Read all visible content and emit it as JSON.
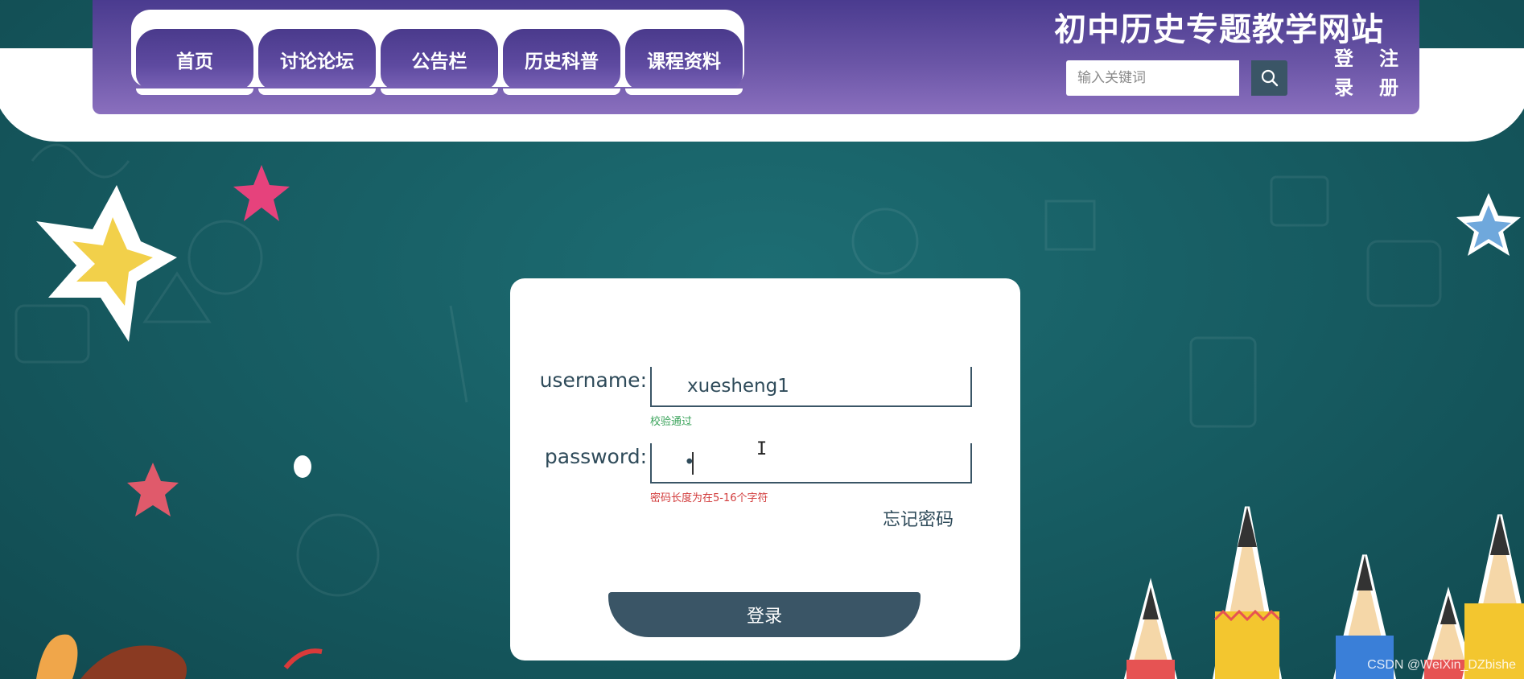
{
  "header": {
    "site_title": "初中历史专题教学网站",
    "nav": [
      {
        "label": "首页"
      },
      {
        "label": "讨论论坛"
      },
      {
        "label": "公告栏"
      },
      {
        "label": "历史科普"
      },
      {
        "label": "课程资料"
      }
    ],
    "search": {
      "placeholder": "输入关键词",
      "icon": "search-icon"
    },
    "login_link": "登录",
    "register_link": "注册"
  },
  "login_form": {
    "username_label": "username:",
    "username_value": "xuesheng1",
    "username_validation": "校验通过",
    "password_label": "password:",
    "password_value": "•",
    "password_validation": "密码长度为在5-16个字符",
    "forgot_password": "忘记密码",
    "submit_label": "登录"
  },
  "colors": {
    "header_purple": "#5e4aa0",
    "button_slate": "#3a5566",
    "background_teal": "#17595f",
    "valid_green": "#3aa35a",
    "error_red": "#d23c3c"
  },
  "watermark": "CSDN @WeiXin_DZbishe"
}
